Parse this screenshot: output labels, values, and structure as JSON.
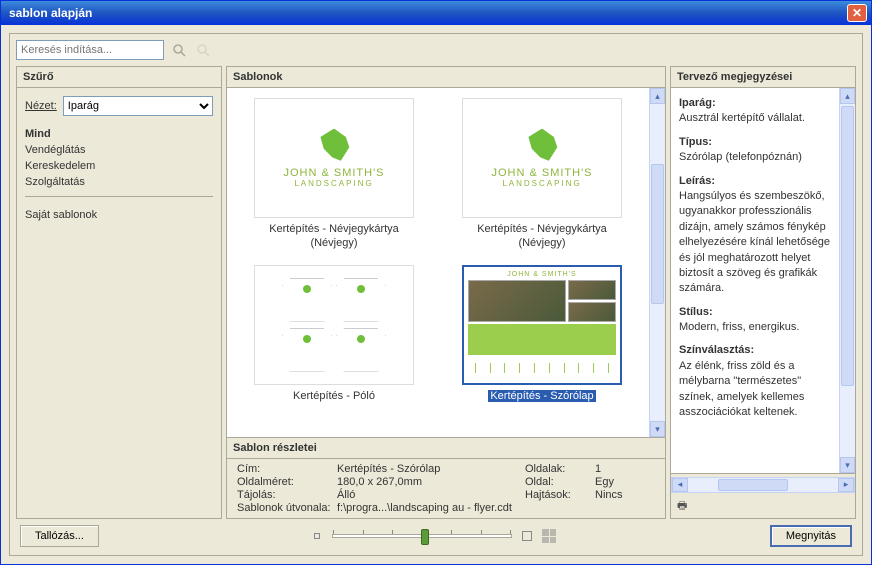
{
  "window": {
    "title": "sablon alapján"
  },
  "search": {
    "placeholder": "Keresés indítása..."
  },
  "filter": {
    "header": "Szűrő",
    "view_label": "Nézet:",
    "view_value": "Iparág",
    "items": [
      "Mind",
      "Vendéglátás",
      "Kereskedelem",
      "Szolgáltatás"
    ],
    "own_templates": "Saját sablonok"
  },
  "templates": {
    "header": "Sablonok",
    "logo_main": "JOHN & SMITH'S",
    "logo_sub": "LANDSCAPING",
    "items": [
      {
        "label": "Kertépítés - Névjegykártya (Névjegy)"
      },
      {
        "label": "Kertépítés - Névjegykártya (Névjegy)"
      },
      {
        "label": "Kertépítés - Póló"
      },
      {
        "label": "Kertépítés - Szórólap",
        "selected": true
      }
    ]
  },
  "details": {
    "header": "Sablon részletei",
    "title_label": "Cím:",
    "title_value": "Kertépítés - Szórólap",
    "pagesize_label": "Oldalméret:",
    "pagesize_value": "180,0 x 267,0mm",
    "orient_label": "Tájolás:",
    "orient_value": "Álló",
    "path_label": "Sablonok útvonala:",
    "path_value": "f:\\progra...\\landscaping au - flyer.cdt",
    "pages_label": "Oldalak:",
    "pages_value": "1",
    "side_label": "Oldal:",
    "side_value": "Egy",
    "fold_label": "Hajtások:",
    "fold_value": "Nincs"
  },
  "notes": {
    "header": "Tervező megjegyzései",
    "industry_k": "Iparág:",
    "industry_v": "Ausztrál kertépítő vállalat.",
    "type_k": "Típus:",
    "type_v": "Szórólap (telefonpóznán)",
    "desc_k": "Leírás:",
    "desc_v": "Hangsúlyos és szembeszökő, ugyanakkor professzionális dizájn, amely számos fénykép elhelyezésére kínál lehetősége és jól meghatározott helyet biztosít a szöveg és grafikák számára.",
    "style_k": "Stílus:",
    "style_v": "Modern, friss, energikus.",
    "color_k": "Színválasztás:",
    "color_v": "Az élénk, friss zöld és a mélybarna \"természetes\" színek, amelyek kellemes asszociációkat keltenek."
  },
  "buttons": {
    "browse": "Tallózás...",
    "open": "Megnyitás"
  }
}
